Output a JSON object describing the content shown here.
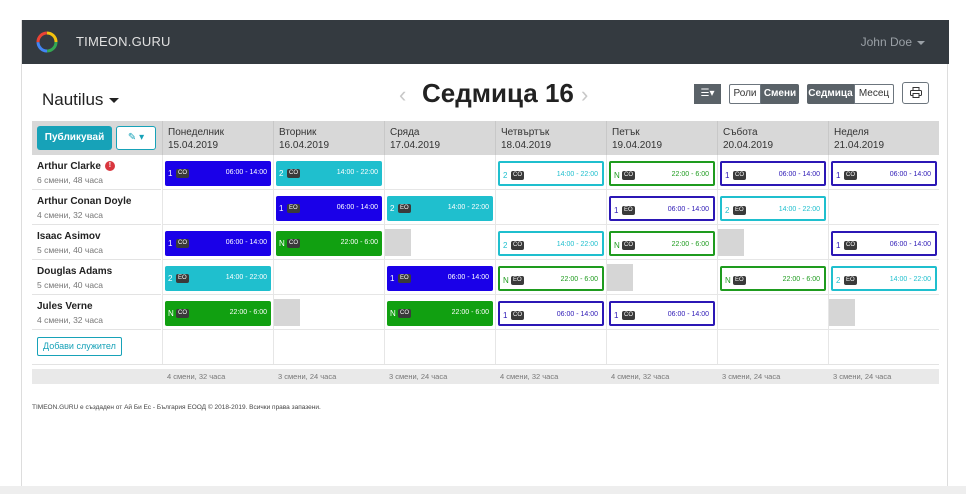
{
  "navbar": {
    "brand": "TIMEON.GURU",
    "user": "John Doe"
  },
  "toolbar": {
    "org": "Nautilus",
    "week_title": "Седмица 16",
    "roles_label": "Роли",
    "shifts_label": "Смени",
    "week_label": "Седмица",
    "month_label": "Месец",
    "publish_label": "Публикувай",
    "add_employee_label": "Добави служител"
  },
  "days": [
    {
      "name": "Понеделник",
      "date": "15.04.2019",
      "summary": "4 смени, 32 часа"
    },
    {
      "name": "Вторник",
      "date": "16.04.2019",
      "summary": "3 смени, 24 часа"
    },
    {
      "name": "Сряда",
      "date": "17.04.2019",
      "summary": "3 смени, 24 часа"
    },
    {
      "name": "Четвъртък",
      "date": "18.04.2019",
      "summary": "4 смени, 32 часа"
    },
    {
      "name": "Петък",
      "date": "19.04.2019",
      "summary": "4 смени, 32 часа"
    },
    {
      "name": "Събота",
      "date": "20.04.2019",
      "summary": "3 смени, 24 часа"
    },
    {
      "name": "Неделя",
      "date": "21.04.2019",
      "summary": "3 смени, 24 часа"
    }
  ],
  "employees": [
    {
      "name": "Arthur Clarke",
      "info": "6 смени, 48 часа",
      "alert": "!"
    },
    {
      "name": "Arthur Conan Doyle",
      "info": "4 смени, 32 часа"
    },
    {
      "name": "Isaac Asimov",
      "info": "5 смени, 40 часа"
    },
    {
      "name": "Douglas Adams",
      "info": "5 смени, 40 часа"
    },
    {
      "name": "Jules Verne",
      "info": "4 смени, 32 часа"
    }
  ],
  "shifts": [
    {
      "row": 0,
      "day": 0,
      "num": "1",
      "tag": "CO",
      "time": "06:00 - 14:00",
      "color": "#1a00e8",
      "style": "filled"
    },
    {
      "row": 0,
      "day": 1,
      "num": "2",
      "tag": "CO",
      "time": "14:00 - 22:00",
      "color": "#1fbfce",
      "style": "filled"
    },
    {
      "row": 0,
      "day": 3,
      "num": "2",
      "tag": "CO",
      "time": "14:00 - 22:00",
      "color": "#1fbfce",
      "style": "outline"
    },
    {
      "row": 0,
      "day": 4,
      "num": "N",
      "tag": "CO",
      "time": "22:00 - 6:00",
      "color": "#1e9b1e",
      "style": "outline"
    },
    {
      "row": 0,
      "day": 5,
      "num": "1",
      "tag": "CO",
      "time": "06:00 - 14:00",
      "color": "#2b17b5",
      "style": "outline"
    },
    {
      "row": 0,
      "day": 6,
      "num": "1",
      "tag": "CO",
      "time": "06:00 - 14:00",
      "color": "#2b17b5",
      "style": "outline"
    },
    {
      "row": 1,
      "day": 1,
      "num": "1",
      "tag": "EO",
      "time": "06:00 - 14:00",
      "color": "#1a00e8",
      "style": "filled"
    },
    {
      "row": 1,
      "day": 2,
      "num": "2",
      "tag": "EO",
      "time": "14:00 - 22:00",
      "color": "#1fbfce",
      "style": "filled"
    },
    {
      "row": 1,
      "day": 4,
      "num": "1",
      "tag": "EO",
      "time": "06:00 - 14:00",
      "color": "#2b17b5",
      "style": "outline"
    },
    {
      "row": 1,
      "day": 5,
      "num": "2",
      "tag": "EO",
      "time": "14:00 - 22:00",
      "color": "#1fbfce",
      "style": "outline"
    },
    {
      "row": 2,
      "day": 0,
      "num": "1",
      "tag": "CO",
      "time": "06:00 - 14:00",
      "color": "#1a00e8",
      "style": "filled"
    },
    {
      "row": 2,
      "day": 1,
      "num": "N",
      "tag": "CO",
      "time": "22:00 - 6:00",
      "color": "#11a011",
      "style": "filled"
    },
    {
      "row": 2,
      "day": 3,
      "num": "2",
      "tag": "CO",
      "time": "14:00 - 22:00",
      "color": "#1fbfce",
      "style": "outline"
    },
    {
      "row": 2,
      "day": 4,
      "num": "N",
      "tag": "CO",
      "time": "22:00 - 6:00",
      "color": "#1e9b1e",
      "style": "outline"
    },
    {
      "row": 2,
      "day": 6,
      "num": "1",
      "tag": "CO",
      "time": "06:00 - 14:00",
      "color": "#2b17b5",
      "style": "outline"
    },
    {
      "row": 3,
      "day": 0,
      "num": "2",
      "tag": "EO",
      "time": "14:00 - 22:00",
      "color": "#1fbfce",
      "style": "filled"
    },
    {
      "row": 3,
      "day": 2,
      "num": "1",
      "tag": "EO",
      "time": "06:00 - 14:00",
      "color": "#1a00e8",
      "style": "filled"
    },
    {
      "row": 3,
      "day": 3,
      "num": "N",
      "tag": "EO",
      "time": "22:00 - 6:00",
      "color": "#1e9b1e",
      "style": "outline"
    },
    {
      "row": 3,
      "day": 5,
      "num": "N",
      "tag": "EO",
      "time": "22:00 - 6:00",
      "color": "#1e9b1e",
      "style": "outline"
    },
    {
      "row": 3,
      "day": 6,
      "num": "2",
      "tag": "EO",
      "time": "14:00 - 22:00",
      "color": "#1fbfce",
      "style": "outline"
    },
    {
      "row": 4,
      "day": 0,
      "num": "N",
      "tag": "CO",
      "time": "22:00 - 6:00",
      "color": "#11a011",
      "style": "filled"
    },
    {
      "row": 4,
      "day": 2,
      "num": "N",
      "tag": "CO",
      "time": "22:00 - 6:00",
      "color": "#11a011",
      "style": "filled"
    },
    {
      "row": 4,
      "day": 3,
      "num": "1",
      "tag": "CO",
      "time": "06:00 - 14:00",
      "color": "#2b17b5",
      "style": "outline"
    },
    {
      "row": 4,
      "day": 4,
      "num": "1",
      "tag": "CO",
      "time": "06:00 - 14:00",
      "color": "#2b17b5",
      "style": "outline"
    }
  ],
  "grey_slots": [
    {
      "row": 2,
      "day": 2
    },
    {
      "row": 2,
      "day": 5
    },
    {
      "row": 3,
      "day": 4
    },
    {
      "row": 4,
      "day": 1
    },
    {
      "row": 4,
      "day": 6
    }
  ],
  "footer": {
    "copyright": "TIMEON.GURU е създаден от Ай Би Ес - България ЕООД © 2018-2019. Всички права запазени."
  },
  "colors": {
    "navbar": "#343a40",
    "publish": "#17a2b8",
    "alert": "#d9363e"
  }
}
